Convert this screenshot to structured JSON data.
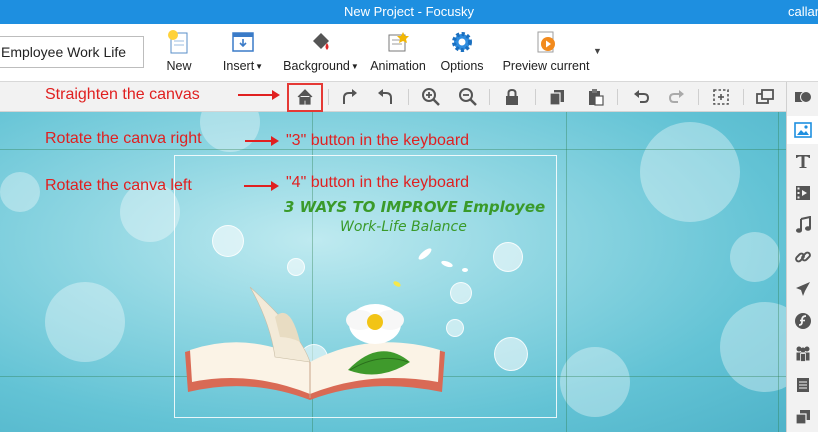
{
  "window": {
    "title": "New Project - Focusky",
    "user": "callan"
  },
  "ribbon": {
    "project_name": "Employee Work Life",
    "new_label": "New",
    "insert_label": "Insert",
    "background_label": "Background",
    "animation_label": "Animation",
    "options_label": "Options",
    "preview_label": "Preview current"
  },
  "canvas": {
    "slide_title_line1": "3 WAYS TO IMPROVE  Employee",
    "slide_title_line2": "Work-Life Balance"
  },
  "annotations": {
    "straighten": "Straighten the canvas",
    "rotate_right": "Rotate the canva right",
    "rotate_left": "Rotate the canva left",
    "key3": "\"3\" button in the keyboard",
    "key4": "\"4\" button in the keyboard"
  },
  "colors": {
    "titlebar": "#1e8fe0",
    "annotation": "#e02020",
    "slide_title": "#3a9a2a"
  },
  "icons": {
    "toolbar": [
      "home-icon",
      "rotate-right-icon",
      "rotate-left-icon",
      "zoom-in-icon",
      "zoom-out-icon",
      "lock-icon",
      "copy-icon",
      "paste-icon",
      "undo-icon",
      "redo-icon",
      "select-area-icon",
      "window-icon"
    ],
    "sidebar": [
      "shapes-icon",
      "image-icon",
      "text-icon",
      "video-icon",
      "music-icon",
      "link-icon",
      "plane-icon",
      "flash-icon",
      "people-icon",
      "slides-icon",
      "layers-icon"
    ]
  }
}
